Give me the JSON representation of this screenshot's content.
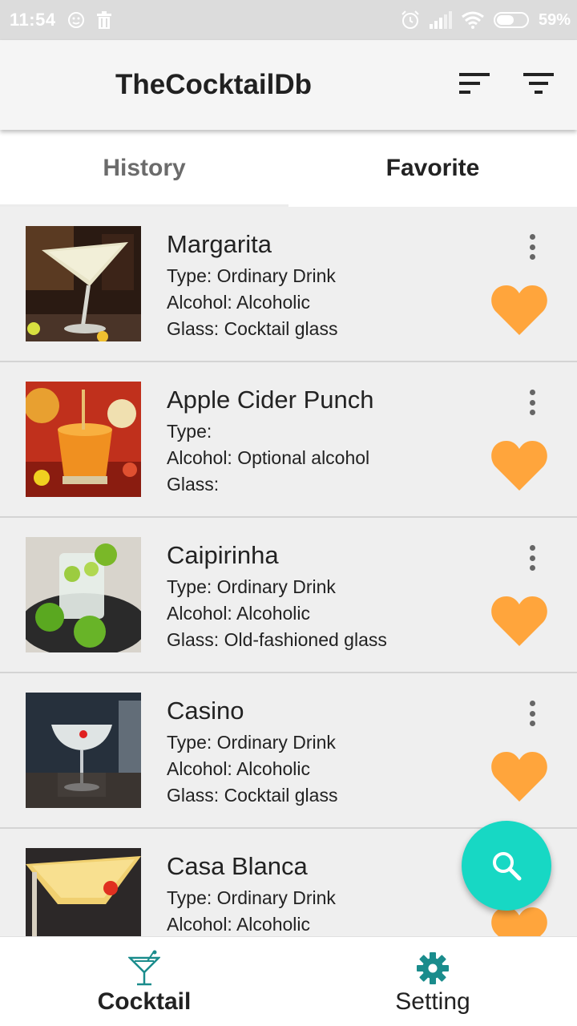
{
  "status_bar": {
    "time": "11:54",
    "battery_percent": "59%",
    "battery_level": 0.59,
    "icons": [
      "face-icon",
      "trash-icon",
      "alarm-icon",
      "signal-icon",
      "wifi-icon",
      "battery-icon"
    ]
  },
  "app_bar": {
    "title": "TheCocktailDb",
    "actions": [
      {
        "icon": "sort-icon"
      },
      {
        "icon": "filter-icon"
      }
    ]
  },
  "tabs": [
    {
      "label": "History",
      "selected": false
    },
    {
      "label": "Favorite",
      "selected": true
    }
  ],
  "drinks": [
    {
      "name": "Margarita",
      "type": "Type: Ordinary Drink",
      "alcohol": "Alcohol: Alcoholic",
      "glass": "Glass: Cocktail glass",
      "favorite": true
    },
    {
      "name": "Apple Cider Punch",
      "type": "Type:",
      "alcohol": "Alcohol: Optional alcohol",
      "glass": "Glass:",
      "favorite": true
    },
    {
      "name": "Caipirinha",
      "type": "Type: Ordinary Drink",
      "alcohol": "Alcohol: Alcoholic",
      "glass": "Glass: Old-fashioned glass",
      "favorite": true
    },
    {
      "name": "Casino",
      "type": "Type: Ordinary Drink",
      "alcohol": "Alcohol: Alcoholic",
      "glass": "Glass: Cocktail glass",
      "favorite": true
    },
    {
      "name": "Casa Blanca",
      "type": "Type: Ordinary Drink",
      "alcohol": "Alcohol: Alcoholic",
      "glass": "",
      "favorite": true
    }
  ],
  "fab": {
    "icon": "search-icon"
  },
  "bottom_nav": [
    {
      "label": "Cocktail",
      "icon": "cocktail-icon",
      "active": true
    },
    {
      "label": "Setting",
      "icon": "gear-icon",
      "active": false
    }
  ],
  "colors": {
    "accent": "#17d8c4",
    "heart": "#ffa53c",
    "nav_icon": "#1a8c8c"
  }
}
